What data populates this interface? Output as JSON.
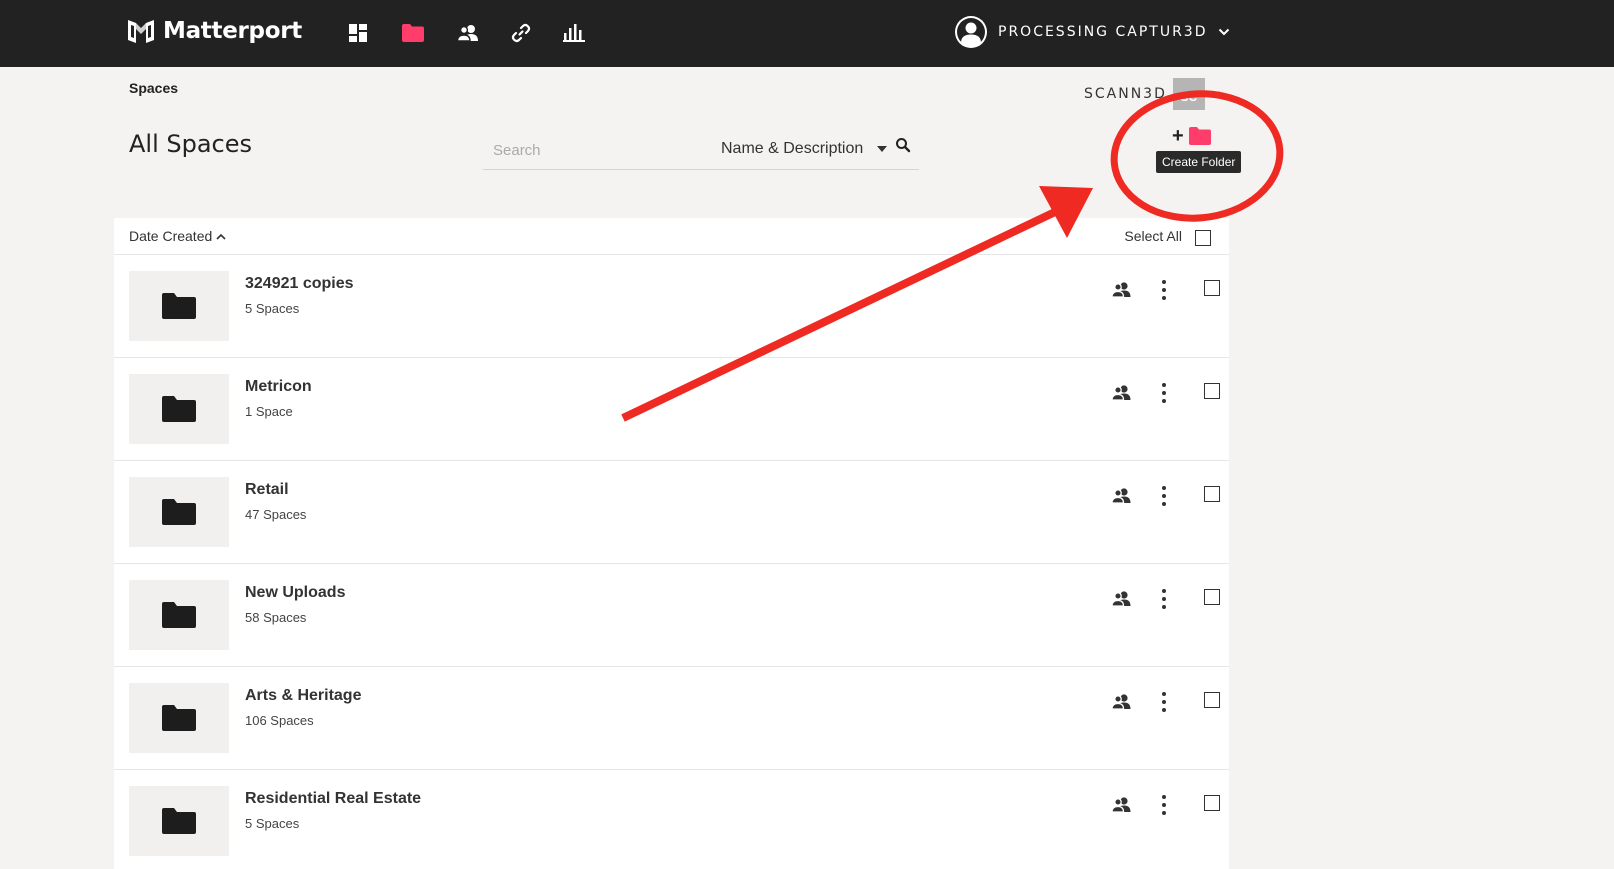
{
  "app": {
    "brand": "Matterport",
    "account_name": "PROCESSING CAPTUR3D",
    "nav": [
      {
        "icon": "dashboard-icon",
        "active": false
      },
      {
        "icon": "folder-icon",
        "active": true
      },
      {
        "icon": "users-icon",
        "active": false
      },
      {
        "icon": "link-icon",
        "active": false
      },
      {
        "icon": "analytics-icon",
        "active": false
      }
    ],
    "accent_color": "#ff3d6a"
  },
  "header": {
    "breadcrumb": "Spaces",
    "title": "All Spaces",
    "org_name": "SCANN3D",
    "org_initials": "SC"
  },
  "search": {
    "placeholder": "Search",
    "value": "",
    "filter_selected": "Name & Description"
  },
  "create_folder": {
    "tooltip": "Create Folder"
  },
  "list": {
    "sort_label": "Date Created",
    "select_all_label": "Select All",
    "rows": [
      {
        "title": "324921 copies",
        "subtitle": "5 Spaces"
      },
      {
        "title": "Metricon",
        "subtitle": "1 Space"
      },
      {
        "title": "Retail",
        "subtitle": "47 Spaces"
      },
      {
        "title": "New Uploads",
        "subtitle": "58 Spaces"
      },
      {
        "title": "Arts & Heritage",
        "subtitle": "106 Spaces"
      },
      {
        "title": "Residential Real Estate",
        "subtitle": "5 Spaces"
      }
    ]
  },
  "annotation": {
    "color": "#ee2a22",
    "shapes": [
      "ellipse",
      "arrow"
    ]
  }
}
